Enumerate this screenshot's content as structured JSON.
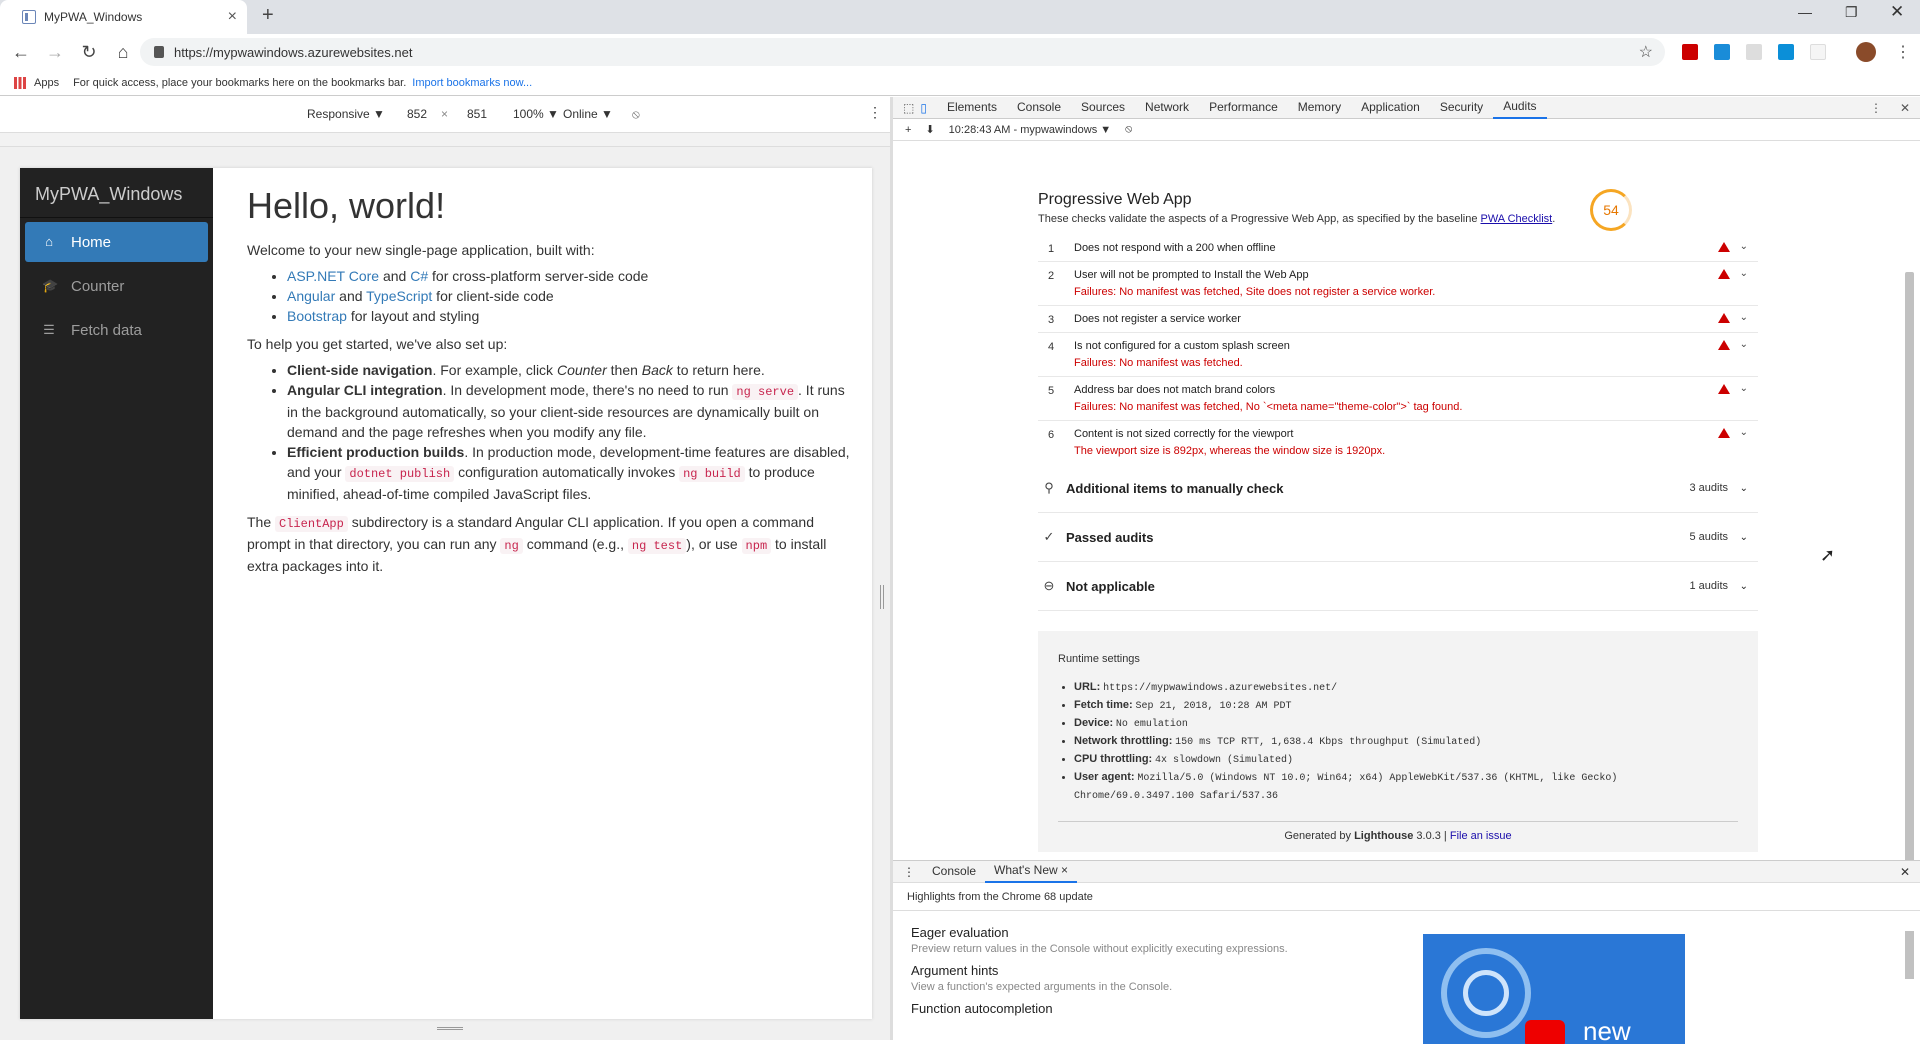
{
  "browser": {
    "tab_title": "MyPWA_Windows",
    "url": "https://mypwawindows.azurewebsites.net",
    "bookmarks_apps": "Apps",
    "bookmarks_hint": "For quick access, place your bookmarks here on the bookmarks bar.",
    "bookmarks_import": "Import bookmarks now..."
  },
  "device_toolbar": {
    "mode": "Responsive ▼",
    "width": "852",
    "times": "×",
    "height": "851",
    "zoom": "100% ▼",
    "network": "Online ▼"
  },
  "app": {
    "brand": "MyPWA_Windows",
    "nav": [
      {
        "label": "Home",
        "icon": "home-icon"
      },
      {
        "label": "Counter",
        "icon": "education-icon"
      },
      {
        "label": "Fetch data",
        "icon": "list-icon"
      }
    ],
    "heading": "Hello, world!",
    "intro": "Welcome to your new single-page application, built with:",
    "built_with": {
      "aspnet": "ASP.NET Core",
      "and1": " and ",
      "csharp": "C#",
      "server_rest": " for cross-platform server-side code",
      "angular": "Angular",
      "and2": " and ",
      "typescript": "TypeScript",
      "client_rest": " for client-side code",
      "bootstrap": "Bootstrap",
      "layout_rest": " for layout and styling"
    },
    "setup_intro": "To help you get started, we've also set up:",
    "setup": {
      "nav_title": "Client-side navigation",
      "nav_text_a": ". For example, click ",
      "nav_counter": "Counter",
      "nav_text_b": " then ",
      "nav_back": "Back",
      "nav_text_c": " to return here.",
      "cli_title": "Angular CLI integration",
      "cli_text_a": ". In development mode, there's no need to run ",
      "cli_code": "ng serve",
      "cli_text_b": ". It runs in the background automatically, so your client-side resources are dynamically built on demand and the page refreshes when you modify any file.",
      "prod_title": "Efficient production builds",
      "prod_text_a": ". In production mode, development-time features are disabled, and your ",
      "prod_code1": "dotnet publish",
      "prod_text_b": " configuration automatically invokes ",
      "prod_code2": "ng build",
      "prod_text_c": " to produce minified, ahead-of-time compiled JavaScript files."
    },
    "footer": {
      "a": "The ",
      "code1": "ClientApp",
      "b": " subdirectory is a standard Angular CLI application. If you open a command prompt in that directory, you can run any ",
      "code2": "ng",
      "c": " command (e.g., ",
      "code3": "ng test",
      "d": "), or use ",
      "code4": "npm",
      "e": " to install extra packages into it."
    }
  },
  "devtools": {
    "tabs": [
      "Elements",
      "Console",
      "Sources",
      "Network",
      "Performance",
      "Memory",
      "Application",
      "Security",
      "Audits"
    ],
    "selected_tab": "Audits",
    "report_select": "10:28:43 AM - mypwawindows ▼",
    "score": "54",
    "score_color": "#f5a623",
    "category_title": "Progressive Web App",
    "category_desc": "These checks validate the aspects of a Progressive Web App, as specified by the baseline ",
    "checklist_link": "PWA Checklist",
    "audits": [
      {
        "num": "1",
        "text": "Does not respond with a 200 when offline",
        "failure": ""
      },
      {
        "num": "2",
        "text": "User will not be prompted to Install the Web App",
        "failure": "Failures: No manifest was fetched, Site does not register a service worker."
      },
      {
        "num": "3",
        "text": "Does not register a service worker",
        "failure": ""
      },
      {
        "num": "4",
        "text": "Is not configured for a custom splash screen",
        "failure": "Failures: No manifest was fetched."
      },
      {
        "num": "5",
        "text": "Address bar does not match brand colors",
        "failure": "Failures: No manifest was fetched, No `<meta name=\"theme-color\">` tag found."
      },
      {
        "num": "6",
        "text": "Content is not sized correctly for the viewport",
        "failure": "The viewport size is 892px, whereas the window size is 1920px."
      }
    ],
    "groups": [
      {
        "label": "Additional items to manually check",
        "count": "3 audits",
        "icon": "search-icon"
      },
      {
        "label": "Passed audits",
        "count": "5 audits",
        "icon": "check-icon"
      },
      {
        "label": "Not applicable",
        "count": "1 audits",
        "icon": "minus-circle-icon"
      }
    ],
    "runtime": {
      "title": "Runtime settings",
      "items": [
        {
          "k": "URL:",
          "v": "https://mypwawindows.azurewebsites.net/"
        },
        {
          "k": "Fetch time:",
          "v": "Sep 21, 2018, 10:28 AM PDT"
        },
        {
          "k": "Device:",
          "v": "No emulation"
        },
        {
          "k": "Network throttling:",
          "v": "150 ms TCP RTT, 1,638.4 Kbps throughput (Simulated)"
        },
        {
          "k": "CPU throttling:",
          "v": "4x slowdown (Simulated)"
        },
        {
          "k": "User agent:",
          "v": "Mozilla/5.0 (Windows NT 10.0; Win64; x64) AppleWebKit/537.36 (KHTML, like Gecko) Chrome/69.0.3497.100 Safari/537.36"
        }
      ]
    },
    "generated": {
      "a": "Generated by ",
      "b": "Lighthouse",
      "c": " 3.0.3 | ",
      "link": "File an issue"
    }
  },
  "drawer": {
    "tabs": [
      "Console",
      "What's New"
    ],
    "close": "×",
    "highlights": "Highlights from the Chrome 68 update",
    "features": [
      {
        "title": "Eager evaluation",
        "desc": "Preview return values in the Console without explicitly executing expressions."
      },
      {
        "title": "Argument hints",
        "desc": "View a function's expected arguments in the Console."
      },
      {
        "title": "Function autocompletion",
        "desc": ""
      }
    ],
    "video_text": "new"
  }
}
